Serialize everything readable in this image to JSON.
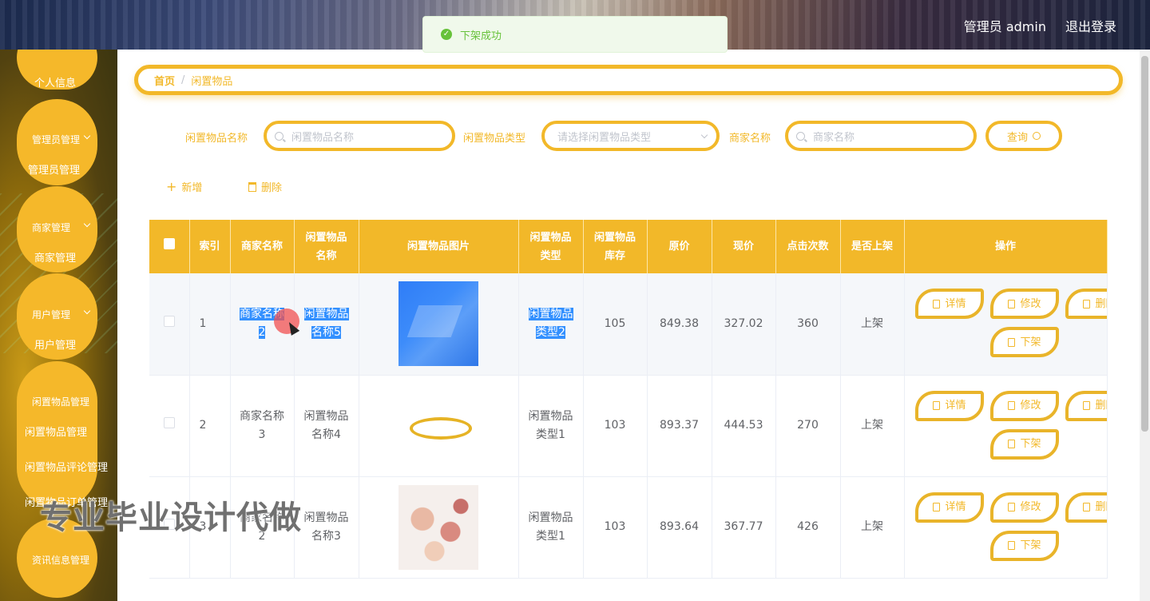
{
  "header": {
    "user_label": "管理员 admin",
    "logout_label": "退出登录"
  },
  "toast": {
    "message": "下架成功"
  },
  "sidebar": {
    "items": [
      {
        "label": "个人信息"
      },
      {
        "group": "管理员管理",
        "sub": "管理员管理"
      },
      {
        "group": "商家管理",
        "sub": "商家管理"
      },
      {
        "group": "用户管理",
        "sub": "用户管理"
      },
      {
        "group": "闲置物品管理",
        "subs": [
          "闲置物品管理",
          "闲置物品评论管理",
          "闲置物品订单管理"
        ]
      },
      {
        "group": "资讯信息管理"
      }
    ]
  },
  "breadcrumb": {
    "home": "首页",
    "separator": "/",
    "current": "闲置物品"
  },
  "search": {
    "name_label": "闲置物品名称",
    "name_placeholder": "闲置物品名称",
    "type_label": "闲置物品类型",
    "type_placeholder": "请选择闲置物品类型",
    "merchant_label": "商家名称",
    "merchant_placeholder": "商家名称",
    "query_label": "查询"
  },
  "toolbar": {
    "add_label": "新增",
    "delete_label": "删除"
  },
  "table": {
    "columns": [
      "索引",
      "商家名称",
      "闲置物品名称",
      "闲置物品图片",
      "闲置物品类型",
      "闲置物品库存",
      "原价",
      "现价",
      "点击次数",
      "是否上架",
      "操作"
    ],
    "rows": [
      {
        "index": "1",
        "merchant": "商家名称2",
        "name": "闲置物品名称5",
        "image": "blue-cosmetics-image",
        "type": "闲置物品类型2",
        "stock": "105",
        "original_price": "849.38",
        "current_price": "327.02",
        "clicks": "360",
        "on_shelf": "上架"
      },
      {
        "index": "2",
        "merchant": "商家名称3",
        "name": "闲置物品名称4",
        "image": "gold-bracelet-image",
        "type": "闲置物品类型1",
        "stock": "103",
        "original_price": "893.37",
        "current_price": "444.53",
        "clicks": "270",
        "on_shelf": "上架"
      },
      {
        "index": "3",
        "merchant": "商家名称2",
        "name": "闲置物品名称3",
        "image": "makeup-powder-image",
        "type": "闲置物品类型1",
        "stock": "103",
        "original_price": "893.64",
        "current_price": "367.77",
        "clicks": "426",
        "on_shelf": "上架"
      }
    ],
    "actions": {
      "detail": "详情",
      "edit": "修改",
      "delete": "删除",
      "offshelf": "下架"
    }
  },
  "watermark": "专业毕业设计代做"
}
